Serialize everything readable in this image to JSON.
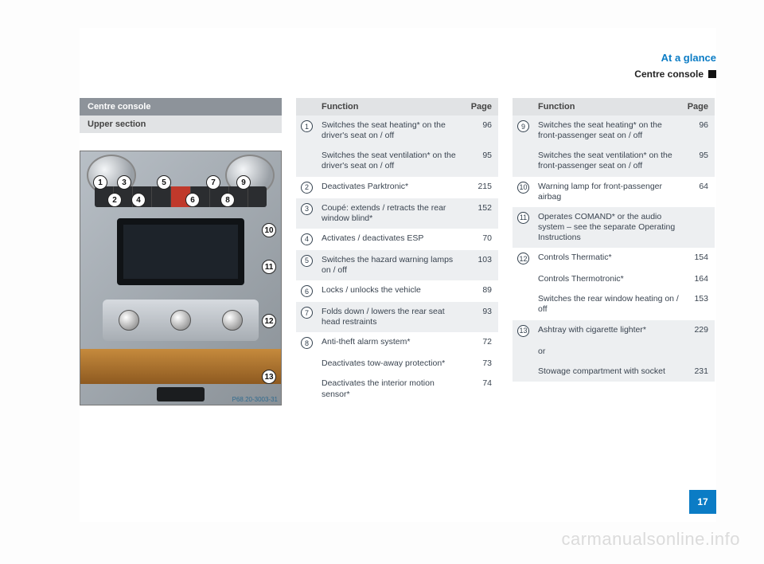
{
  "header": {
    "chapter": "At a glance",
    "section": "Centre console"
  },
  "left": {
    "box_title": "Centre console",
    "subtitle": "Upper section",
    "fig_caption": "P68.20-3003-31",
    "callouts": [
      "1",
      "2",
      "3",
      "4",
      "5",
      "6",
      "7",
      "8",
      "9",
      "10",
      "11",
      "12",
      "13"
    ]
  },
  "table_head": {
    "function": "Function",
    "page": "Page"
  },
  "col1": [
    {
      "num": "1",
      "alt": true,
      "items": [
        {
          "text": "Switches the seat heating* on the driver's seat on / off",
          "page": "96"
        },
        {
          "text": "Switches the seat ventilation* on the driver's seat on / off",
          "page": "95"
        }
      ]
    },
    {
      "num": "2",
      "alt": false,
      "items": [
        {
          "text": "Deactivates Parktronic*",
          "page": "215"
        }
      ]
    },
    {
      "num": "3",
      "alt": true,
      "items": [
        {
          "text": "Coupé: extends / retracts the rear window blind*",
          "page": "152"
        }
      ]
    },
    {
      "num": "4",
      "alt": false,
      "items": [
        {
          "text": "Activates / deactivates ESP",
          "page": "70"
        }
      ]
    },
    {
      "num": "5",
      "alt": true,
      "items": [
        {
          "text": "Switches the hazard warning lamps on / off",
          "page": "103"
        }
      ]
    },
    {
      "num": "6",
      "alt": false,
      "items": [
        {
          "text": "Locks / unlocks the vehicle",
          "page": "89"
        }
      ]
    },
    {
      "num": "7",
      "alt": true,
      "items": [
        {
          "text": "Folds down / lowers the rear seat head restraints",
          "page": "93"
        }
      ]
    },
    {
      "num": "8",
      "alt": false,
      "items": [
        {
          "text": "Anti-theft alarm system*",
          "page": "72"
        },
        {
          "text": "Deactivates tow-away protection*",
          "page": "73"
        },
        {
          "text": "Deactivates the interior motion sensor*",
          "page": "74"
        }
      ]
    }
  ],
  "col2": [
    {
      "num": "9",
      "alt": true,
      "items": [
        {
          "text": "Switches the seat heating* on the front-passenger seat on / off",
          "page": "96"
        },
        {
          "text": "Switches the seat ventilation* on the front-passenger seat on / off",
          "page": "95"
        }
      ]
    },
    {
      "num": "10",
      "alt": false,
      "items": [
        {
          "text": "Warning lamp for front-passenger airbag",
          "page": "64"
        }
      ]
    },
    {
      "num": "11",
      "alt": true,
      "items": [
        {
          "text": "Operates COMAND* or the audio system – see the separate Operating Instructions",
          "page": ""
        }
      ]
    },
    {
      "num": "12",
      "alt": false,
      "items": [
        {
          "text": "Controls Thermatic*",
          "page": "154"
        },
        {
          "text": "Controls Thermotronic*",
          "page": "164"
        },
        {
          "text": "Switches the rear window heating on / off",
          "page": "153"
        }
      ]
    },
    {
      "num": "13",
      "alt": true,
      "items": [
        {
          "text": "Ashtray with cigarette lighter*",
          "page": "229"
        },
        {
          "text": "or",
          "page": ""
        },
        {
          "text": "Stowage compartment with socket",
          "page": "231"
        }
      ]
    }
  ],
  "page_number": "17",
  "watermark": "carmanualsonline.info"
}
